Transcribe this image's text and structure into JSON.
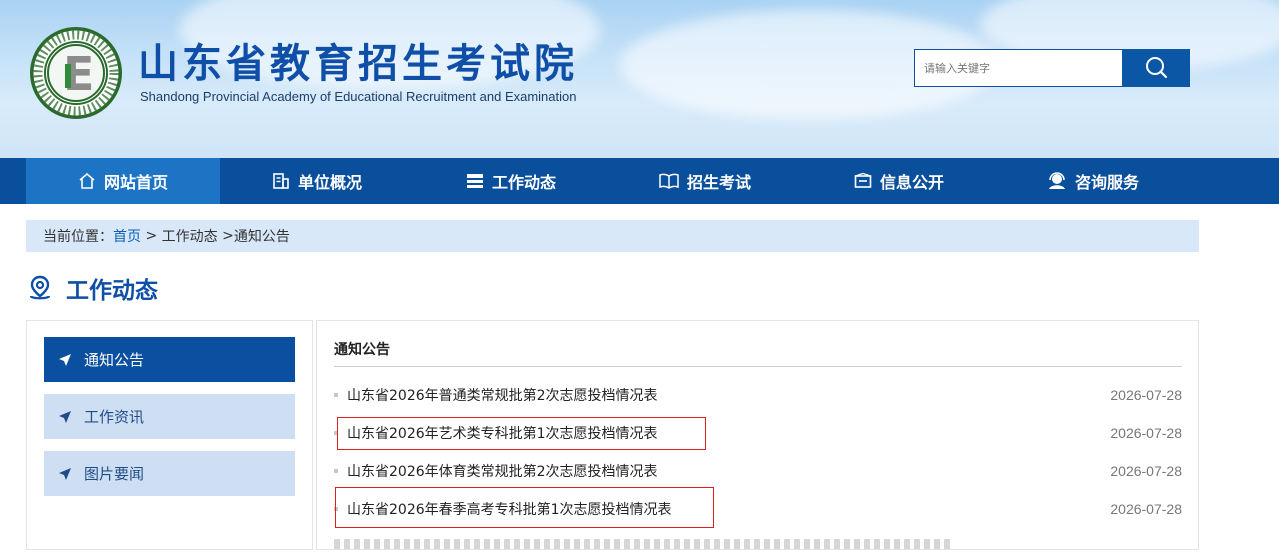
{
  "header": {
    "site_title": "山东省教育招生考试院",
    "site_subtitle": "Shandong Provincial Academy of Educational Recruitment and Examination",
    "logo_ring_text": "Shandong Educational Admission & Examination",
    "logo_bottom_text": "山东省教育招生考试",
    "search_placeholder": "请输入关键字"
  },
  "nav": {
    "items": [
      {
        "label": "网站首页",
        "icon": "home-icon",
        "active": true
      },
      {
        "label": "单位概况",
        "icon": "building-icon",
        "active": false
      },
      {
        "label": "工作动态",
        "icon": "list-icon",
        "active": false
      },
      {
        "label": "招生考试",
        "icon": "book-icon",
        "active": false
      },
      {
        "label": "信息公开",
        "icon": "inbox-icon",
        "active": false
      },
      {
        "label": "咨询服务",
        "icon": "support-icon",
        "active": false
      }
    ]
  },
  "breadcrumb": {
    "prefix": "当前位置：",
    "home": "首页",
    "sep1": " > ",
    "section": "工作动态",
    "sep2": " >",
    "current": "通知公告"
  },
  "section": {
    "title": "工作动态",
    "icon": "location-pin-icon"
  },
  "sidebar": {
    "items": [
      {
        "label": "通知公告",
        "active": true
      },
      {
        "label": "工作资讯",
        "active": false
      },
      {
        "label": "图片要闻",
        "active": false
      }
    ]
  },
  "content": {
    "title": "通知公告",
    "items": [
      {
        "title": "山东省2026年普通类常规批第2次志愿投档情况表",
        "date": "2026-07-28",
        "highlighted": false
      },
      {
        "title": "山东省2026年艺术类专科批第1次志愿投档情况表",
        "date": "2026-07-28",
        "highlighted": true
      },
      {
        "title": "山东省2026年体育类常规批第2次志愿投档情况表",
        "date": "2026-07-28",
        "highlighted": false
      },
      {
        "title": "山东省2026年春季高考专科批第1次志愿投档情况表",
        "date": "2026-07-28",
        "highlighted": true
      }
    ]
  },
  "colors": {
    "brand_blue": "#0a4f9c",
    "nav_active": "#1d74c4",
    "highlight_red": "#e02020"
  }
}
